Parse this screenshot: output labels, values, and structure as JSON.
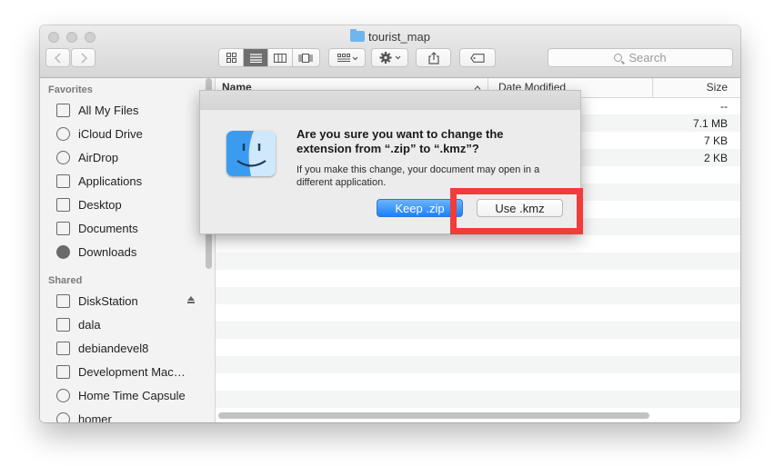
{
  "window": {
    "title": "tourist_map"
  },
  "toolbar": {
    "view_icons": [
      "icon-view-icon",
      "list-view-icon",
      "column-view-icon",
      "coverflow-view-icon"
    ],
    "arrange_icon": "arrange-icon",
    "action_icon": "gear-icon",
    "share_icon": "share-icon",
    "tag_icon": "tag-icon"
  },
  "search": {
    "placeholder": "Search"
  },
  "sidebar": {
    "favorites_heading": "Favorites",
    "favorites": [
      {
        "label": "All My Files",
        "icon": "all-files-icon"
      },
      {
        "label": "iCloud Drive",
        "icon": "cloud-icon"
      },
      {
        "label": "AirDrop",
        "icon": "airdrop-icon"
      },
      {
        "label": "Applications",
        "icon": "applications-icon"
      },
      {
        "label": "Desktop",
        "icon": "desktop-icon"
      },
      {
        "label": "Documents",
        "icon": "documents-icon"
      },
      {
        "label": "Downloads",
        "icon": "downloads-icon"
      }
    ],
    "shared_heading": "Shared",
    "shared": [
      {
        "label": "DiskStation",
        "icon": "server-icon"
      },
      {
        "label": "dala",
        "icon": "monitor-icon"
      },
      {
        "label": "debiandevel8",
        "icon": "monitor-icon"
      },
      {
        "label": "Development Mac…",
        "icon": "monitor-icon"
      },
      {
        "label": "Home Time Capsule",
        "icon": "time-capsule-icon"
      },
      {
        "label": "homer",
        "icon": "time-capsule-icon"
      }
    ]
  },
  "columns": {
    "name": "Name",
    "modified": "Date Modified",
    "size": "Size"
  },
  "rows": [
    {
      "modified_fragment": "",
      "size": "--"
    },
    {
      "modified_fragment": "",
      "size": "7.1 MB"
    },
    {
      "modified_fragment": "",
      "size": "7 KB"
    },
    {
      "modified_fragment": "",
      "size": "2 KB"
    }
  ],
  "dialog": {
    "title": "Are you sure you want to change the extension from “.zip” to “.kmz”?",
    "message": "If you make this change, your document may open in a different application.",
    "keep_button": "Keep .zip",
    "use_button": "Use .kmz"
  },
  "colors": {
    "accent": "#1a82fb",
    "highlight": "#f23b3b",
    "finder_left": "#3a9cf0",
    "finder_right": "#cfe8fb"
  }
}
